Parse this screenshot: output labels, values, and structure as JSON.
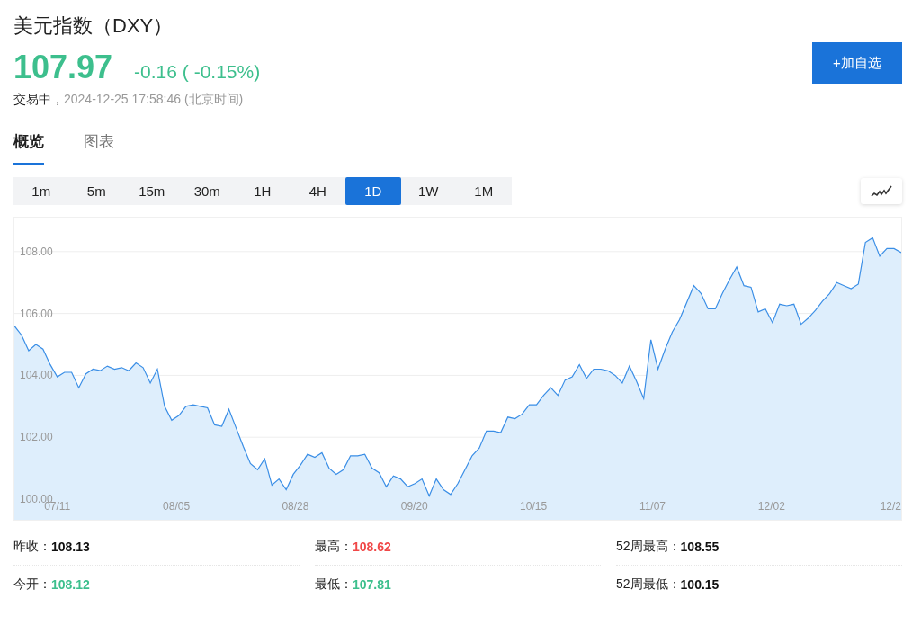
{
  "header": {
    "title": "美元指数（DXY）",
    "price": "107.97",
    "change": "-0.16 ( -0.15%)",
    "status": "交易中，",
    "timestamp": "2024-12-25 17:58:46 (北京时间)",
    "add_button": "+加自选"
  },
  "tabs": [
    {
      "label": "概览",
      "selected": true
    },
    {
      "label": "图表",
      "selected": false
    }
  ],
  "intervals": [
    {
      "label": "1m",
      "selected": false
    },
    {
      "label": "5m",
      "selected": false
    },
    {
      "label": "15m",
      "selected": false
    },
    {
      "label": "30m",
      "selected": false
    },
    {
      "label": "1H",
      "selected": false
    },
    {
      "label": "4H",
      "selected": false
    },
    {
      "label": "1D",
      "selected": true
    },
    {
      "label": "1W",
      "selected": false
    },
    {
      "label": "1M",
      "selected": false
    }
  ],
  "chart": {
    "x_labels": [
      "07/11",
      "08/05",
      "08/28",
      "09/20",
      "10/15",
      "11/07",
      "12/02",
      "12/2"
    ],
    "chart_data": {
      "type": "area",
      "grid": true,
      "ylim": [
        99.33,
        109.1
      ],
      "yticks": [
        {
          "value": 100,
          "label": "100.00"
        },
        {
          "value": 102,
          "label": "102.00"
        },
        {
          "value": 104,
          "label": "104.00"
        },
        {
          "value": 106,
          "label": "106.00"
        },
        {
          "value": 108,
          "label": "108.00"
        }
      ],
      "series": [
        {
          "color": "#3a8ee6",
          "values": [
            105.6,
            105.3,
            104.8,
            105.0,
            104.85,
            104.35,
            103.95,
            104.1,
            104.1,
            103.6,
            104.05,
            104.2,
            104.15,
            104.3,
            104.2,
            104.25,
            104.15,
            104.4,
            104.25,
            103.75,
            104.2,
            103.0,
            102.55,
            102.7,
            103.0,
            103.05,
            103.0,
            102.95,
            102.4,
            102.35,
            102.9,
            102.3,
            101.7,
            101.15,
            100.95,
            101.3,
            100.45,
            100.65,
            100.3,
            100.8,
            101.1,
            101.45,
            101.35,
            101.5,
            101.0,
            100.8,
            100.95,
            101.4,
            101.4,
            101.45,
            101.0,
            100.85,
            100.4,
            100.75,
            100.65,
            100.4,
            100.5,
            100.65,
            100.1,
            100.65,
            100.3,
            100.15,
            100.5,
            100.95,
            101.4,
            101.65,
            102.2,
            102.2,
            102.15,
            102.65,
            102.6,
            102.75,
            103.05,
            103.05,
            103.35,
            103.6,
            103.35,
            103.85,
            103.95,
            104.35,
            103.9,
            104.2,
            104.2,
            104.15,
            104.0,
            103.75,
            104.3,
            103.8,
            103.25,
            105.15,
            104.2,
            104.85,
            105.4,
            105.8,
            106.35,
            106.9,
            106.65,
            106.15,
            106.15,
            106.65,
            107.1,
            107.5,
            106.9,
            106.85,
            106.05,
            106.15,
            105.7,
            106.3,
            106.25,
            106.3,
            105.65,
            105.85,
            106.1,
            106.4,
            106.65,
            107.0,
            106.9,
            106.8,
            106.95,
            108.3,
            108.45,
            107.85,
            108.1,
            108.1,
            107.97
          ]
        }
      ]
    }
  },
  "stats": [
    [
      {
        "label": "昨收：",
        "value": "108.13",
        "color": "#111111"
      },
      {
        "label": "今开：",
        "value": "108.12",
        "color": "#3dbf8d"
      }
    ],
    [
      {
        "label": "最高：",
        "value": "108.62",
        "color": "#f04848"
      },
      {
        "label": "最低：",
        "value": "107.81",
        "color": "#3dbf8d"
      }
    ],
    [
      {
        "label": "52周最高：",
        "value": "108.55",
        "color": "#111111"
      },
      {
        "label": "52周最低：",
        "value": "100.15",
        "color": "#111111"
      }
    ]
  ]
}
